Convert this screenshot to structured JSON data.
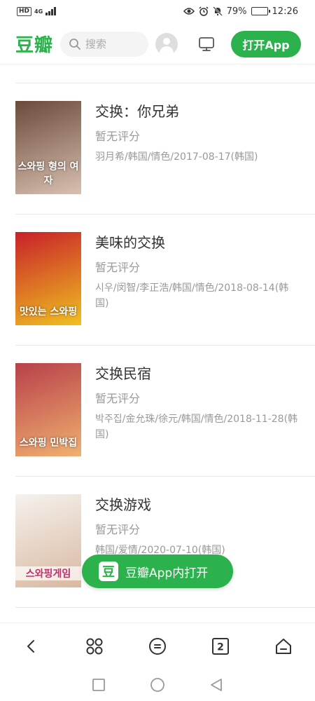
{
  "status_bar": {
    "hd": "HD",
    "network": "4G",
    "battery": "79%",
    "battery_level": 0.79,
    "time": "12:26"
  },
  "header": {
    "logo": "豆瓣",
    "search_placeholder": "搜索",
    "open_app": "打开App"
  },
  "items": [
    {
      "title": "交换：你兄弟",
      "rating": "暂无评分",
      "meta": "羽月希/韩国/情色/2017-08-17(韩国)",
      "poster_text": "스와핑 형의 여자",
      "poster_colors": [
        "#6b4a3a",
        "#d8c0b0"
      ]
    },
    {
      "title": "美味的交换",
      "rating": "暂无评分",
      "meta": "시우/闵智/李正浩/韩国/情色/2018-08-14(韩国)",
      "poster_text": "맛있는 스와핑",
      "poster_colors": [
        "#c8202a",
        "#f0c020"
      ]
    },
    {
      "title": "交换民宿",
      "rating": "暂无评分",
      "meta": "박주집/金允珠/徐元/韩国/情色/2018-11-28(韩国)",
      "poster_text": "스와핑 민박집",
      "poster_colors": [
        "#b8404a",
        "#f0b070"
      ]
    },
    {
      "title": "交换游戏",
      "rating": "暂无评分",
      "meta": "韩国/爱情/2020-07-10(韩国)",
      "poster_text": "스와핑게임",
      "poster_colors": [
        "#f5f2ee",
        "#d9b8a0"
      ]
    }
  ],
  "float_button": {
    "logo": "豆",
    "label": "豆瓣App内打开"
  },
  "browser_bar": {
    "tabs_count": "2"
  },
  "colors": {
    "brand_green": "#2bb24c"
  }
}
